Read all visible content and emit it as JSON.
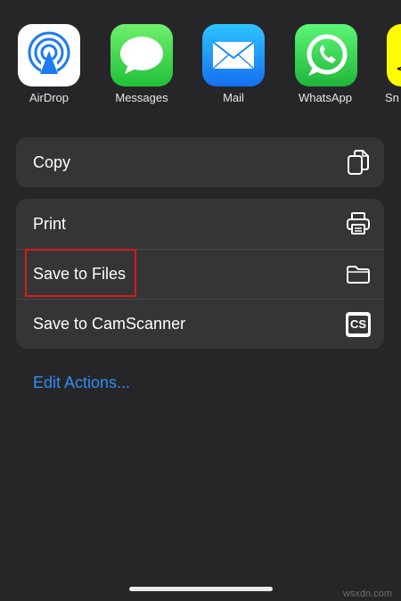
{
  "share_apps": [
    {
      "label": "AirDrop",
      "icon": "airdrop-icon"
    },
    {
      "label": "Messages",
      "icon": "messages-icon"
    },
    {
      "label": "Mail",
      "icon": "mail-icon"
    },
    {
      "label": "WhatsApp",
      "icon": "whatsapp-icon"
    },
    {
      "label": "Sn",
      "icon": "snapchat-icon"
    }
  ],
  "actions_group1": [
    {
      "label": "Copy",
      "icon": "copy-icon"
    }
  ],
  "actions_group2": [
    {
      "label": "Print",
      "icon": "printer-icon"
    },
    {
      "label": "Save to Files",
      "icon": "folder-icon"
    },
    {
      "label": "Save to CamScanner",
      "icon": "camscanner-icon",
      "icon_text": "CS"
    }
  ],
  "edit_actions": "Edit Actions...",
  "watermark": "wsxdn.com",
  "colors": {
    "background": "#262628",
    "group": "#353537",
    "link": "#2f8ef5",
    "highlight": "#d71a1a"
  }
}
